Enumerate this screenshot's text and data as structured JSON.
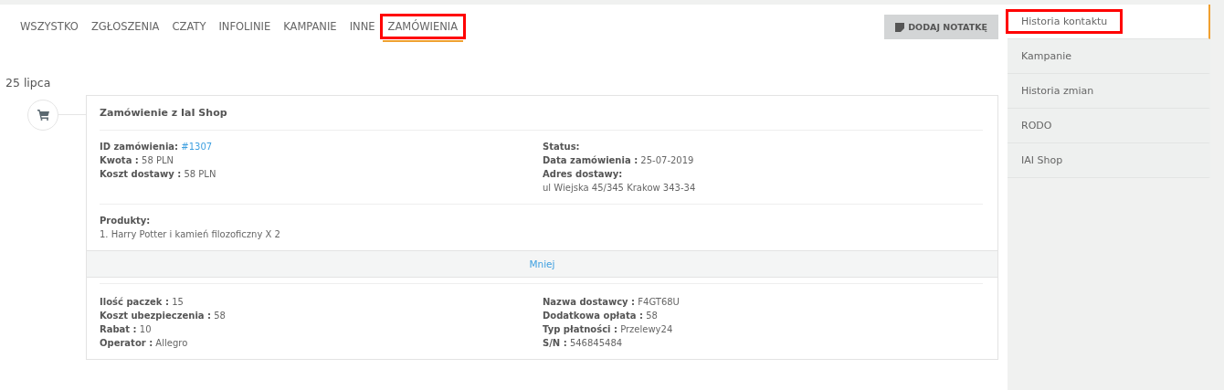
{
  "tabs": [
    {
      "label": "WSZYSTKO",
      "selected": false,
      "highlighted": false
    },
    {
      "label": "ZGŁOSZENIA",
      "selected": false,
      "highlighted": false
    },
    {
      "label": "CZATY",
      "selected": false,
      "highlighted": false
    },
    {
      "label": "INFOLINIE",
      "selected": false,
      "highlighted": false
    },
    {
      "label": "KAMPANIE",
      "selected": false,
      "highlighted": false
    },
    {
      "label": "INNE",
      "selected": false,
      "highlighted": false
    },
    {
      "label": "ZAMÓWIENIA",
      "selected": true,
      "highlighted": true
    }
  ],
  "add_note_button": {
    "label": "DODAJ NOTATKĘ"
  },
  "date": "25 lipca",
  "order": {
    "title": "Zamówienie z IaI Shop",
    "summary_left": [
      {
        "label": "ID zamówienia:",
        "value": "#1307",
        "kind": "link"
      },
      {
        "label": "Kwota :",
        "value": "58 PLN",
        "kind": "inline"
      },
      {
        "label": "Koszt dostawy :",
        "value": "58 PLN",
        "kind": "inline"
      }
    ],
    "summary_right": [
      {
        "label": "Status:",
        "kind": "inline"
      },
      {
        "label": "Data zamówienia :",
        "value": "25-07-2019",
        "kind": "inline"
      },
      {
        "label": "Adres dostawy:",
        "value": "ul Wiejska 45/345 Krakow 343-34",
        "kind": "block"
      }
    ],
    "products": {
      "label": "Produkty:",
      "items": [
        "1. Harry Potter i kamień filozoficzny X 2"
      ]
    },
    "toggle": "Mniej",
    "details_left": [
      {
        "label": "Ilość paczek :",
        "value": "15",
        "kind": "inline"
      },
      {
        "label": "Koszt ubezpieczenia :",
        "value": "58",
        "kind": "inline"
      },
      {
        "label": "Rabat :",
        "value": "10",
        "kind": "inline"
      },
      {
        "label": "Operator :",
        "value": "Allegro",
        "kind": "inline"
      }
    ],
    "details_right": [
      {
        "label": "Nazwa dostawcy :",
        "value": "F4GT68U",
        "kind": "inline"
      },
      {
        "label": "Dodatkowa opłata :",
        "value": "58",
        "kind": "inline"
      },
      {
        "label": "Typ płatności :",
        "value": "Przelewy24",
        "kind": "inline"
      },
      {
        "label": "S/N :",
        "value": "546845484",
        "kind": "inline"
      }
    ]
  },
  "side_menu": [
    {
      "label": "Historia kontaktu",
      "selected": true,
      "highlighted": true
    },
    {
      "label": "Kampanie",
      "selected": false,
      "highlighted": false
    },
    {
      "label": "Historia zmian",
      "selected": false,
      "highlighted": false
    },
    {
      "label": "RODO",
      "selected": false,
      "highlighted": false
    },
    {
      "label": "IAI Shop",
      "selected": false,
      "highlighted": false
    }
  ]
}
